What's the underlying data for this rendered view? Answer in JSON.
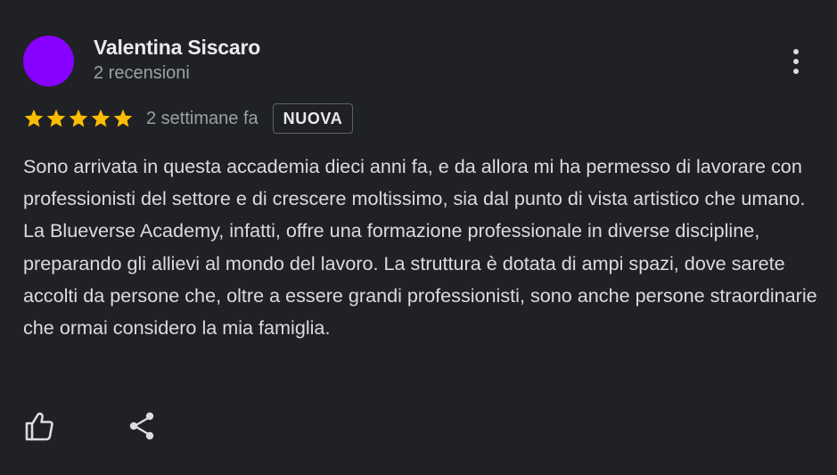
{
  "review": {
    "author_name": "Valentina Siscaro",
    "author_meta": "2 recensioni",
    "rating": 5,
    "rating_max": 5,
    "time_ago": "2 settimane fa",
    "badge": "NUOVA",
    "text": "Sono arrivata in questa accademia dieci anni fa, e da allora mi ha permesso di lavorare con professionisti del settore e di crescere moltissimo, sia dal punto di vista artistico che umano. La Blueverse Academy, infatti, offre una formazione professionale in diverse discipline, preparando gli allievi al mondo del lavoro. La struttura è dotata di ampi spazi, dove sarete accolti da persone che, oltre a essere grandi professionisti, sono anche persone straordinarie che ormai considero la mia famiglia."
  },
  "colors": {
    "background": "#202124",
    "avatar": "#8800ff",
    "star": "#fbbc04",
    "text_primary": "#e8eaed",
    "text_secondary": "#9aa0a6"
  },
  "icons": {
    "more": "more-vert-icon",
    "star": "star-icon",
    "like": "thumb-up-icon",
    "share": "share-icon"
  }
}
